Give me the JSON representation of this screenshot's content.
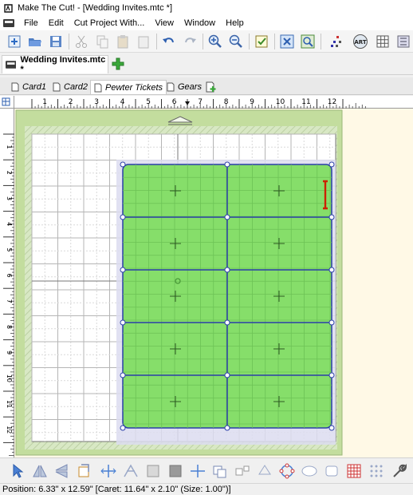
{
  "window": {
    "title": "Make The Cut! - [Wedding Invites.mtc *]"
  },
  "menu": {
    "items": [
      "File",
      "Edit",
      "Cut Project With...",
      "View",
      "Window",
      "Help"
    ]
  },
  "toolbar": {
    "items": [
      {
        "icon": "new-icon"
      },
      {
        "icon": "open-folder-icon"
      },
      {
        "icon": "save-icon"
      },
      {
        "icon": "cut-icon"
      },
      {
        "icon": "copy-icon"
      },
      {
        "icon": "paste-icon"
      },
      {
        "icon": "paste-in-place-icon"
      },
      {
        "icon": "undo-icon"
      },
      {
        "icon": "redo-icon"
      },
      {
        "icon": "zoom-in-icon"
      },
      {
        "icon": "zoom-out-icon"
      },
      {
        "icon": "checklist-icon"
      },
      {
        "icon": "node-edit-icon"
      },
      {
        "icon": "zoom-to-fit-icon"
      },
      {
        "icon": "pixel-trace-icon"
      },
      {
        "icon": "art-icon"
      },
      {
        "icon": "grid-icon"
      },
      {
        "icon": "settings-icon"
      }
    ]
  },
  "document_tab": {
    "label": "Wedding Invites.mtc *"
  },
  "page_tabs": [
    {
      "label": "Card1",
      "active": false
    },
    {
      "label": "Card2",
      "active": false
    },
    {
      "label": "Pewter Tickets",
      "active": true
    },
    {
      "label": "Gears",
      "active": false
    }
  ],
  "ruler": {
    "top_labels": [
      "1",
      "2",
      "3",
      "4",
      "5",
      "6",
      "7",
      "8",
      "9",
      "10",
      "11",
      "12"
    ],
    "left_labels": [
      "1",
      "2",
      "3",
      "4",
      "5",
      "6",
      "7",
      "8",
      "9",
      "10",
      "11",
      "12"
    ]
  },
  "colors": {
    "mat_green": "#c3dd9e",
    "shape_green": "#86de6a",
    "cut_line_blue": "#2a3fa8",
    "canvas_background": "#fff9e6",
    "caret_red": "#cc2200"
  },
  "status": {
    "position": "Position: 6.33\" x 12.59\" [Caret: 11.64\" x 2.10\" (Size: 1.00\")]"
  }
}
